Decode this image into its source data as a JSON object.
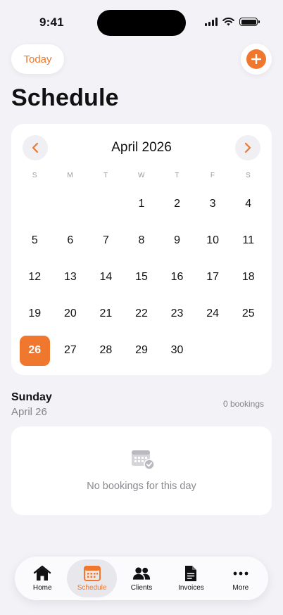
{
  "status_bar": {
    "time": "9:41"
  },
  "header": {
    "today_label": "Today",
    "title": "Schedule"
  },
  "calendar": {
    "month_label": "April 2026",
    "weekdays": [
      "S",
      "M",
      "T",
      "W",
      "T",
      "F",
      "S"
    ],
    "days": [
      "",
      "",
      "",
      "1",
      "2",
      "3",
      "4",
      "5",
      "6",
      "7",
      "8",
      "9",
      "10",
      "11",
      "12",
      "13",
      "14",
      "15",
      "16",
      "17",
      "18",
      "19",
      "20",
      "21",
      "22",
      "23",
      "24",
      "25",
      "26",
      "27",
      "28",
      "29",
      "30",
      "",
      ""
    ],
    "selected_day": "26"
  },
  "selected_day": {
    "weekday": "Sunday",
    "date": "April 26",
    "booking_count": "0 bookings"
  },
  "empty_state": {
    "icon": "calendar-check-icon",
    "text": "No bookings for this day"
  },
  "tab_bar": {
    "items": [
      {
        "label": "Home",
        "icon": "home-icon"
      },
      {
        "label": "Schedule",
        "icon": "calendar-icon",
        "active": true
      },
      {
        "label": "Clients",
        "icon": "people-icon"
      },
      {
        "label": "Invoices",
        "icon": "document-icon"
      },
      {
        "label": "More",
        "icon": "ellipsis-icon"
      }
    ]
  },
  "colors": {
    "accent": "#f0772e",
    "background": "#f2f2f7",
    "card": "#ffffff"
  }
}
